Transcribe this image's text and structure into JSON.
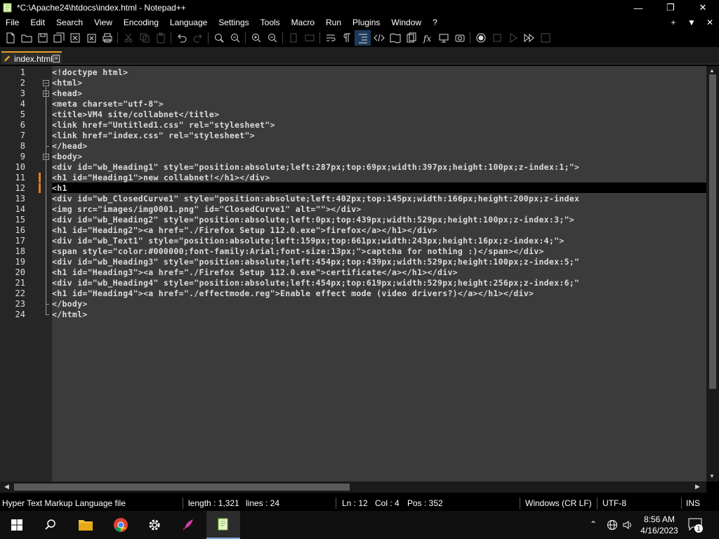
{
  "window": {
    "title": "*C:\\Apache24\\htdocs\\index.html - Notepad++",
    "minimize": "—",
    "restore": "❐",
    "close": "✕"
  },
  "menu": {
    "items": [
      "File",
      "Edit",
      "Search",
      "View",
      "Encoding",
      "Language",
      "Settings",
      "Tools",
      "Macro",
      "Run",
      "Plugins",
      "Window",
      "?"
    ],
    "right_plus": "+",
    "right_down": "▼",
    "right_close": "✕"
  },
  "tab": {
    "label": "index.html",
    "close": "✕"
  },
  "editor": {
    "line_numbers": [
      "1",
      "2",
      "3",
      "4",
      "5",
      "6",
      "7",
      "8",
      "9",
      "10",
      "11",
      "12",
      "13",
      "14",
      "15",
      "16",
      "17",
      "18",
      "19",
      "20",
      "21",
      "22",
      "23",
      "24"
    ],
    "lines": [
      "<!doctype html>",
      "<html>",
      "<head>",
      "<meta charset=\"utf-8\">",
      "<title>VM4 site/collabnet</title>",
      "<link href=\"Untitled1.css\" rel=\"stylesheet\">",
      "<link href=\"index.css\" rel=\"stylesheet\">",
      "</head>",
      "<body>",
      "<div id=\"wb_Heading1\" style=\"position:absolute;left:287px;top:69px;width:397px;height:100px;z-index:1;\">",
      "<h1 id=\"Heading1\">new collabnet!</h1></div>",
      "<h1",
      "<div id=\"wb_ClosedCurve1\" style=\"position:absolute;left:402px;top:145px;width:166px;height:200px;z-index",
      "<img src=\"images/img0001.png\" id=\"ClosedCurve1\" alt=\"\"></div>",
      "<div id=\"wb_Heading2\" style=\"position:absolute;left:0px;top:439px;width:529px;height:100px;z-index:3;\">",
      "<h1 id=\"Heading2\"><a href=\"./Firefox Setup 112.0.exe\">firefox</a></h1></div>",
      "<div id=\"wb_Text1\" style=\"position:absolute;left:159px;top:661px;width:243px;height:16px;z-index:4;\">",
      "<span style=\"color:#000000;font-family:Arial;font-size:13px;\">captcha for nothing :)</span></div>",
      "<div id=\"wb_Heading3\" style=\"position:absolute;left:454px;top:439px;width:529px;height:100px;z-index:5;\"",
      "<h1 id=\"Heading3\"><a href=\"./Firefox Setup 112.0.exe\">certificate</a></h1></div>",
      "<div id=\"wb_Heading4\" style=\"position:absolute;left:454px;top:619px;width:529px;height:256px;z-index:6;\"",
      "<h1 id=\"Heading4\"><a href=\"./effectmode.reg\">Enable effect mode (video drivers?)</a></h1></div>",
      "</body>",
      "</html>"
    ]
  },
  "status": {
    "file_type": "Hyper Text Markup Language file",
    "length": "length : 1,321",
    "lines": "lines : 24",
    "ln": "Ln : 12",
    "col": "Col : 4",
    "pos": "Pos : 352",
    "eol": "Windows (CR LF)",
    "encoding": "UTF-8",
    "mode": "INS"
  },
  "taskbar": {
    "time": "8:56 AM",
    "date": "4/16/2023",
    "notifications": "1"
  },
  "colors": {
    "accent_tab": "#e8a21e",
    "change_mark": "#e77b1c",
    "string": "#e29fa0"
  }
}
